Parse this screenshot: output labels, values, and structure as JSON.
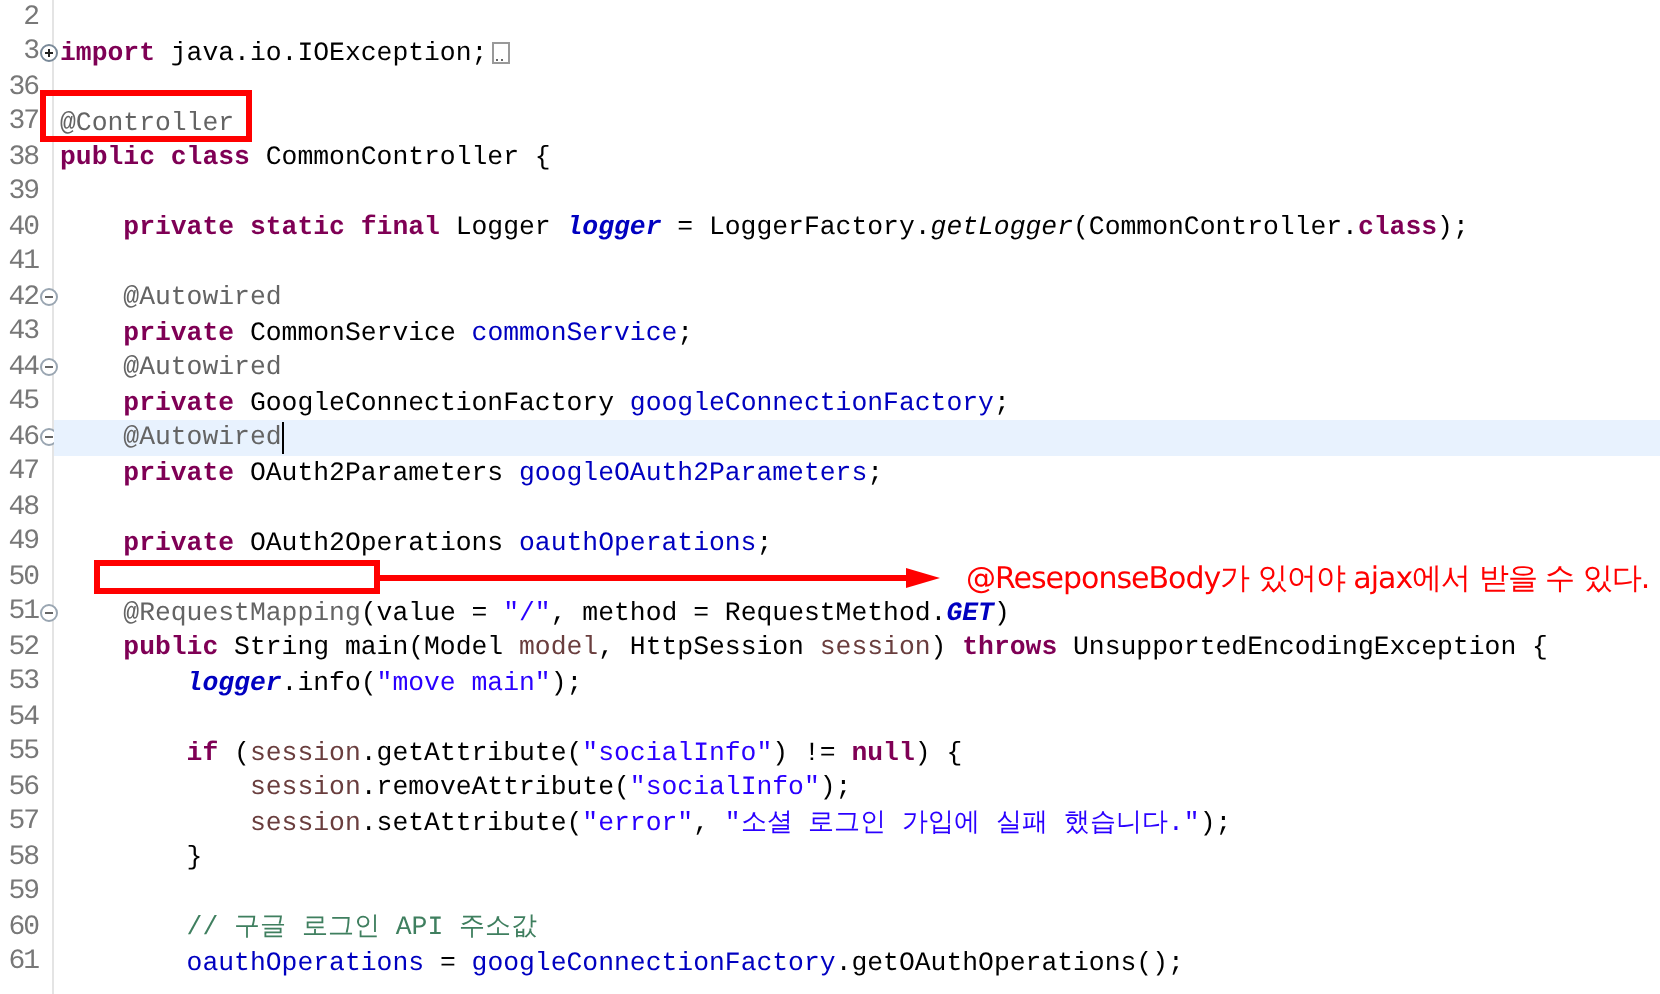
{
  "editor": {
    "lines": [
      {
        "number": "2",
        "current": false,
        "marked": false
      },
      {
        "number": "3",
        "expanded": false,
        "current": false,
        "marked": false,
        "tokens": [
          {
            "kind": "keyword",
            "text": "import"
          },
          {
            "kind": "plain",
            "text": " java.io.IOException;"
          }
        ]
      },
      {
        "number": "36",
        "current": false,
        "marked": false
      },
      {
        "number": "37",
        "current": false,
        "marked": true,
        "tokens": [
          {
            "kind": "annotation",
            "text": "@Controller"
          }
        ]
      },
      {
        "number": "38",
        "current": false,
        "marked": false,
        "tokens": [
          {
            "kind": "keyword",
            "text": "public class"
          },
          {
            "kind": "plain",
            "text": " CommonController {"
          }
        ]
      },
      {
        "number": "39",
        "current": false,
        "marked": false
      },
      {
        "number": "40",
        "current": false,
        "marked": false,
        "tokens": [
          {
            "kind": "keyword",
            "text": "    private static final"
          },
          {
            "kind": "plain",
            "text": " Logger "
          },
          {
            "kind": "static",
            "text": "logger"
          },
          {
            "kind": "plain",
            "text": " = LoggerFactory."
          },
          {
            "kind": "method",
            "text": "getLogger"
          },
          {
            "kind": "plain",
            "text": "(CommonController."
          },
          {
            "kind": "keyword",
            "text": "class"
          },
          {
            "kind": "plain",
            "text": ");"
          }
        ]
      },
      {
        "number": "41",
        "current": false,
        "marked": false
      },
      {
        "number": "42",
        "expanded": true,
        "current": false,
        "marked": false,
        "tokens": [
          {
            "kind": "annotation",
            "text": "    @Autowired"
          }
        ]
      },
      {
        "number": "43",
        "current": false,
        "marked": false,
        "tokens": [
          {
            "kind": "keyword",
            "text": "    private"
          },
          {
            "kind": "plain",
            "text": " CommonService "
          },
          {
            "kind": "field",
            "text": "commonService"
          },
          {
            "kind": "plain",
            "text": ";"
          }
        ]
      },
      {
        "number": "44",
        "expanded": true,
        "current": false,
        "marked": false,
        "tokens": [
          {
            "kind": "annotation",
            "text": "    @Autowired"
          }
        ]
      },
      {
        "number": "45",
        "current": false,
        "marked": false,
        "tokens": [
          {
            "kind": "keyword",
            "text": "    private"
          },
          {
            "kind": "plain",
            "text": " GoogleConnectionFactory "
          },
          {
            "kind": "field",
            "text": "googleConnectionFactory"
          },
          {
            "kind": "plain",
            "text": ";"
          }
        ]
      },
      {
        "number": "46",
        "expanded": true,
        "current": true,
        "marked": false,
        "tokens": [
          {
            "kind": "annotation",
            "text": "    @Autowired"
          }
        ]
      },
      {
        "number": "47",
        "current": false,
        "marked": false,
        "tokens": [
          {
            "kind": "keyword",
            "text": "    private"
          },
          {
            "kind": "plain",
            "text": " OAuth2Parameters "
          },
          {
            "kind": "field",
            "text": "googleOAuth2Parameters"
          },
          {
            "kind": "plain",
            "text": ";"
          }
        ]
      },
      {
        "number": "48",
        "current": false,
        "marked": false
      },
      {
        "number": "49",
        "current": false,
        "marked": false,
        "tokens": [
          {
            "kind": "keyword",
            "text": "    private"
          },
          {
            "kind": "plain",
            "text": " OAuth2Operations "
          },
          {
            "kind": "field",
            "text": "oauthOperations"
          },
          {
            "kind": "plain",
            "text": ";"
          }
        ]
      },
      {
        "number": "50",
        "current": false,
        "marked": true,
        "note": "@ReseponseBody가 있어야 ajax에서 받을 수 있다."
      },
      {
        "number": "51",
        "expanded": true,
        "current": false,
        "marked": false,
        "tokens": [
          {
            "kind": "annotation",
            "text": "    @RequestMapping"
          },
          {
            "kind": "plain",
            "text": "(value = "
          },
          {
            "kind": "string",
            "text": "\"/\""
          },
          {
            "kind": "plain",
            "text": ", method = RequestMethod."
          },
          {
            "kind": "constant",
            "text": "GET"
          },
          {
            "kind": "plain",
            "text": ")"
          }
        ]
      },
      {
        "number": "52",
        "current": false,
        "marked": false,
        "tokens": [
          {
            "kind": "keyword",
            "text": "    public"
          },
          {
            "kind": "plain",
            "text": " String main(Model "
          },
          {
            "kind": "variable",
            "text": "model"
          },
          {
            "kind": "plain",
            "text": ", HttpSession "
          },
          {
            "kind": "variable",
            "text": "session"
          },
          {
            "kind": "plain",
            "text": ") "
          },
          {
            "kind": "keyword",
            "text": "throws"
          },
          {
            "kind": "plain",
            "text": " UnsupportedEncodingException {"
          }
        ]
      },
      {
        "number": "53",
        "current": false,
        "marked": false,
        "tokens": [
          {
            "kind": "static",
            "text": "        logger"
          },
          {
            "kind": "plain",
            "text": ".info("
          },
          {
            "kind": "string",
            "text": "\"move main\""
          },
          {
            "kind": "plain",
            "text": ");"
          }
        ]
      },
      {
        "number": "54",
        "current": false,
        "marked": false
      },
      {
        "number": "55",
        "current": false,
        "marked": false,
        "tokens": [
          {
            "kind": "keyword",
            "text": "        if"
          },
          {
            "kind": "plain",
            "text": " ("
          },
          {
            "kind": "variable",
            "text": "session"
          },
          {
            "kind": "plain",
            "text": ".getAttribute("
          },
          {
            "kind": "string",
            "text": "\"socialInfo\""
          },
          {
            "kind": "plain",
            "text": ") != "
          },
          {
            "kind": "keyword",
            "text": "null"
          },
          {
            "kind": "plain",
            "text": ") {"
          }
        ]
      },
      {
        "number": "56",
        "current": false,
        "marked": false,
        "tokens": [
          {
            "kind": "variable",
            "text": "            session"
          },
          {
            "kind": "plain",
            "text": ".removeAttribute("
          },
          {
            "kind": "string",
            "text": "\"socialInfo\""
          },
          {
            "kind": "plain",
            "text": ");"
          }
        ]
      },
      {
        "number": "57",
        "current": false,
        "marked": false,
        "tokens": [
          {
            "kind": "variable",
            "text": "            session"
          },
          {
            "kind": "plain",
            "text": ".setAttribute("
          },
          {
            "kind": "string",
            "text": "\"error\""
          },
          {
            "kind": "plain",
            "text": ", "
          },
          {
            "kind": "string",
            "text": "\"소셜 로그인 가입에 실패 했습니다.\""
          },
          {
            "kind": "plain",
            "text": ");"
          }
        ]
      },
      {
        "number": "58",
        "current": false,
        "marked": false,
        "tokens": [
          {
            "kind": "plain",
            "text": "        }"
          }
        ]
      },
      {
        "number": "59",
        "current": false,
        "marked": false
      },
      {
        "number": "60",
        "current": false,
        "marked": false,
        "tokens": [
          {
            "kind": "comment",
            "text": "        // 구글 로그인 API 주소값"
          }
        ]
      },
      {
        "number": "61",
        "current": false,
        "marked": false,
        "tokens": [
          {
            "kind": "field",
            "text": "        oauthOperations"
          },
          {
            "kind": "plain",
            "text": " = "
          },
          {
            "kind": "field",
            "text": "googleConnectionFactory"
          },
          {
            "kind": "plain",
            "text": ".getOAuthOperations();"
          }
        ]
      }
    ]
  }
}
